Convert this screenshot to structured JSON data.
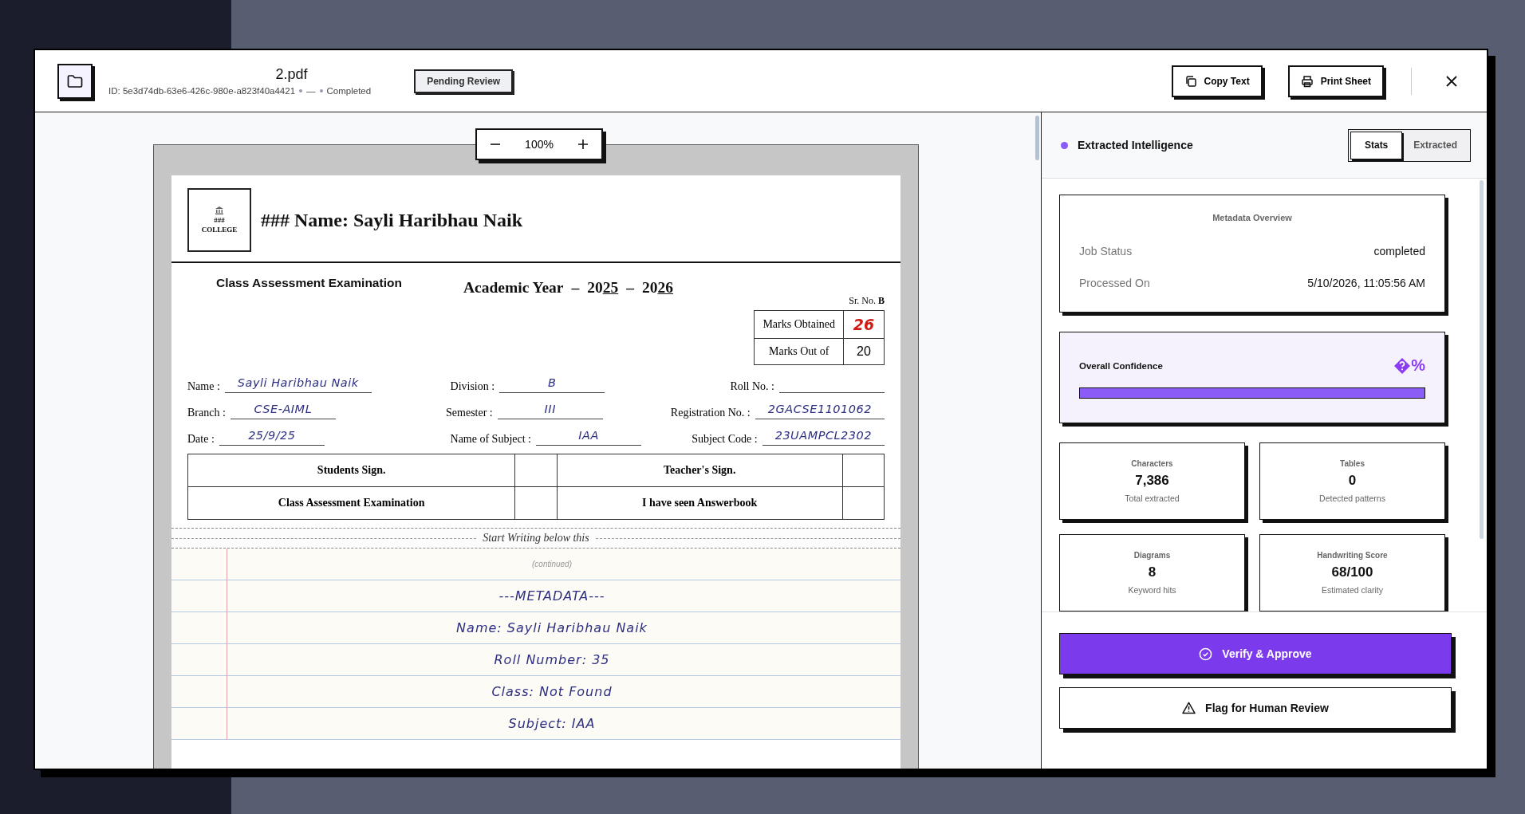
{
  "header": {
    "file_name": "2.pdf",
    "id_text": "ID: 5e3d74db-63e6-426c-980e-a823f40a4421",
    "separator": "—",
    "status": "Completed",
    "badge": "Pending Review",
    "buttons": [
      {
        "label": "Copy Text",
        "kind": "copy"
      },
      {
        "label": "Print Sheet",
        "kind": "print"
      }
    ]
  },
  "zoom": {
    "level_text": "100%"
  },
  "document": {
    "logo": {
      "mark": "###",
      "name": "COLLEGE"
    },
    "heading": "### Name: Sayli Haribhau Naik",
    "exam_title": "Class Assessment Examination",
    "academic_year": [
      {
        "text": "Academic Year",
        "underline": false
      },
      {
        "text": "–",
        "underline": false
      },
      {
        "text": "20",
        "underline": false
      },
      {
        "text": "25",
        "underline": true
      },
      {
        "text": "–",
        "underline": false
      },
      {
        "text": "20",
        "underline": false
      },
      {
        "text": "26",
        "underline": true
      }
    ],
    "sr_no": {
      "label": "Sr. No.",
      "value": "B"
    },
    "marks": [
      {
        "label": "Marks Obtained",
        "value": "26",
        "kind": "handwritten"
      },
      {
        "label": "Marks Out of",
        "value": "20",
        "kind": "printed"
      }
    ],
    "field_rows": [
      [
        {
          "label": "Name :",
          "value": "Sayli Haribhau Naik"
        },
        {
          "label": "Division :",
          "value": "B"
        },
        {
          "label": "Roll No. :"
        }
      ],
      [
        {
          "label": "Branch :",
          "value": "CSE-AIML"
        },
        {
          "label": "Semester :",
          "value": "III"
        },
        {
          "label": "Registration No. :",
          "value": "2GACSE1101062"
        }
      ],
      [
        {
          "label": "Date :",
          "value": "25/9/25"
        },
        {
          "label": "Name of Subject :",
          "value": "IAA"
        },
        {
          "label": "Subject Code :",
          "value": "23UAMPCL2302"
        }
      ]
    ],
    "sign_table": [
      [
        "Students Sign.",
        "Teacher's Sign."
      ],
      [
        "Class Assessment Examination",
        "I have seen Answerbook"
      ]
    ],
    "divider_text": "Start Writing below this",
    "continued": "(continued)",
    "answer_lines": [
      "---METADATA---",
      "Name: Sayli Haribhau Naik",
      "Roll Number: 35",
      "Class: Not Found",
      "Subject: IAA"
    ]
  },
  "panel": {
    "title": "Extracted Intelligence",
    "tabs": [
      {
        "label": "Stats",
        "selected": true
      },
      {
        "label": "Extracted",
        "selected": false
      }
    ],
    "metadata": {
      "title": "Metadata Overview",
      "rows": [
        {
          "label": "Job Status",
          "value": "completed"
        },
        {
          "label": "Processed On",
          "value": "5/10/2026, 11:05:56 AM"
        }
      ]
    },
    "confidence": {
      "label": "Overall Confidence",
      "value": "%",
      "level": 1
    },
    "stats": [
      {
        "title": "Characters",
        "value": "7,386",
        "caption": "Total extracted"
      },
      {
        "title": "Tables",
        "value": "0",
        "caption": "Detected patterns"
      },
      {
        "title": "Diagrams",
        "value": "8",
        "caption": "Keyword hits"
      },
      {
        "title": "Handwriting Score",
        "value": "68/100",
        "caption": "Estimated clarity"
      }
    ],
    "actions": [
      {
        "label": "Verify & Approve",
        "kind": "primary"
      },
      {
        "label": "Flag for Human Review",
        "kind": "flag"
      }
    ]
  }
}
